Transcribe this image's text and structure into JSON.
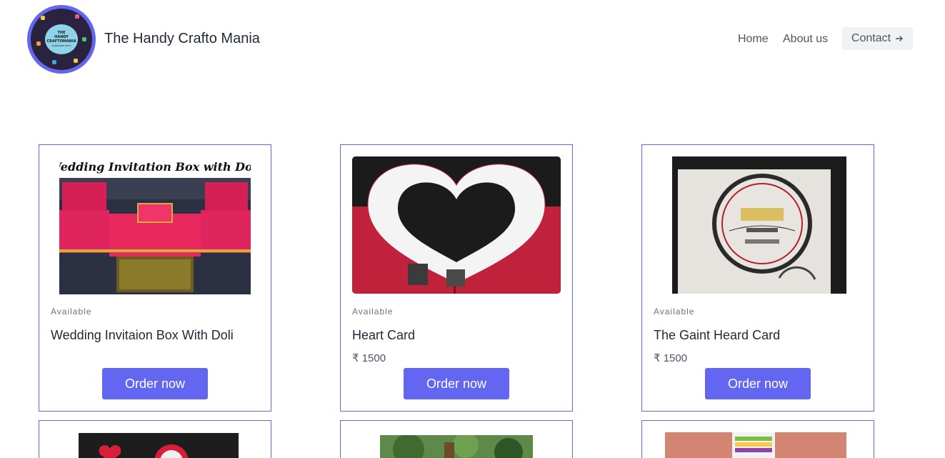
{
  "header": {
    "brand": "The Handy Crafto Mania",
    "logo_text": [
      "THE",
      "HANDY",
      "CRAFTOMANIA",
      "HANDMADE GIFTS"
    ],
    "nav": {
      "home": "Home",
      "about": "About us",
      "contact": "Contact"
    }
  },
  "colors": {
    "accent": "#6366f1",
    "button_text": "#ffffff",
    "contact_bg": "#f1f2f4"
  },
  "products": [
    {
      "image_caption": "Wedding Invitation Box with Doli",
      "status": "Available",
      "name": "Wedding Invitaion Box With Doli",
      "price": "",
      "button": "Order now"
    },
    {
      "status": "Available",
      "name": "Heart Card",
      "price": "₹ 1500",
      "button": "Order now"
    },
    {
      "status": "Available",
      "name": "The Gaint Heard Card",
      "price": "₹ 1500",
      "button": "Order now"
    }
  ],
  "icons": {
    "contact_arrow": "arrow-right-icon"
  }
}
